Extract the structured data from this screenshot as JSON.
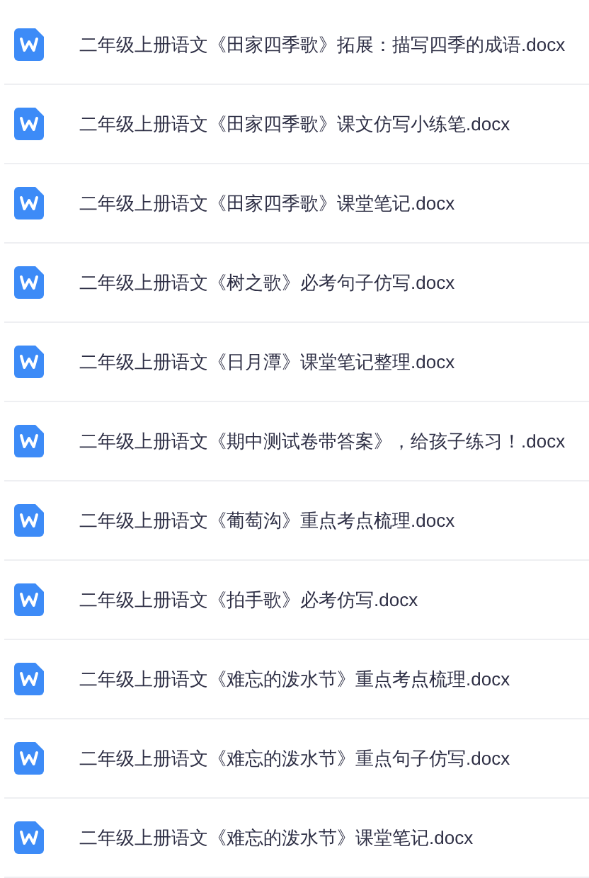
{
  "files": [
    {
      "name": "二年级上册语文《田家四季歌》拓展：描写四季的成语.docx"
    },
    {
      "name": "二年级上册语文《田家四季歌》课文仿写小练笔.docx"
    },
    {
      "name": "二年级上册语文《田家四季歌》课堂笔记.docx"
    },
    {
      "name": "二年级上册语文《树之歌》必考句子仿写.docx"
    },
    {
      "name": "二年级上册语文《日月潭》课堂笔记整理.docx"
    },
    {
      "name": "二年级上册语文《期中测试卷带答案》，给孩子练习！.docx"
    },
    {
      "name": "二年级上册语文《葡萄沟》重点考点梳理.docx"
    },
    {
      "name": "二年级上册语文《拍手歌》必考仿写.docx"
    },
    {
      "name": "二年级上册语文《难忘的泼水节》重点考点梳理.docx"
    },
    {
      "name": "二年级上册语文《难忘的泼水节》重点句子仿写.docx"
    },
    {
      "name": "二年级上册语文《难忘的泼水节》课堂笔记.docx"
    }
  ]
}
